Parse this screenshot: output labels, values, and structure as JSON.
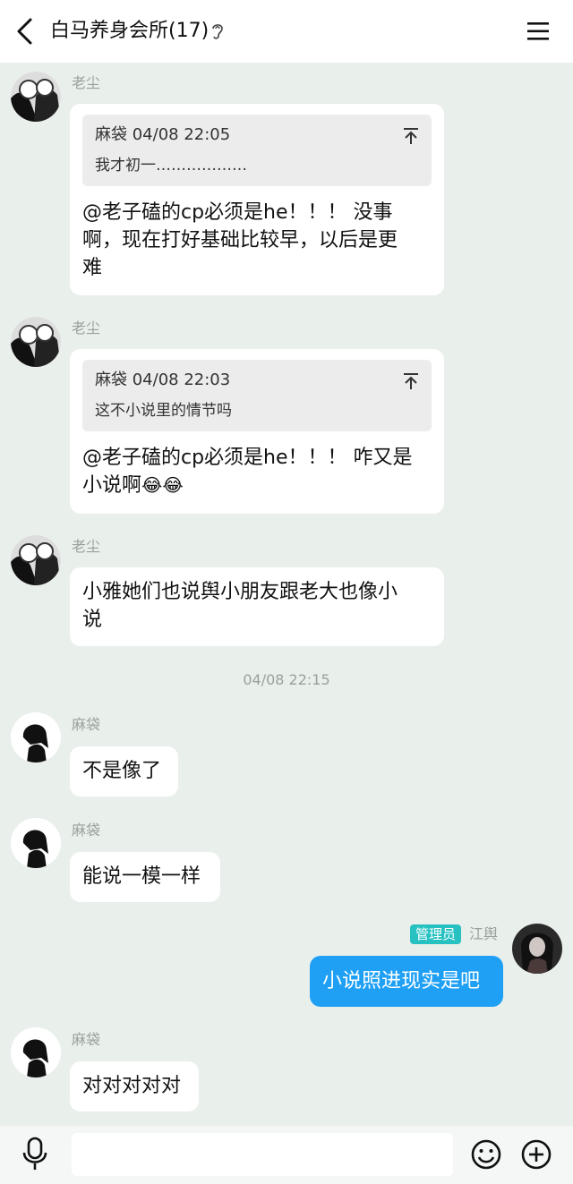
{
  "header": {
    "title": "白马养身会所(17)"
  },
  "messages": [
    {
      "sender": "老尘",
      "quote": {
        "author_time": "麻袋 04/08 22:05",
        "text": "我才初一………………"
      },
      "text_lines": [
        "@老子磕的cp必须是he！！！ 没事",
        "啊，现在打好基础比较早，以后是更",
        "难"
      ]
    },
    {
      "sender": "老尘",
      "quote": {
        "author_time": "麻袋 04/08 22:03",
        "text": "这不小说里的情节吗"
      },
      "text_lines": [
        "@老子磕的cp必须是he！！！ 咋又是",
        "小说啊"
      ],
      "emoji": "😂😂"
    },
    {
      "sender": "老尘",
      "text_lines": [
        "小雅她们也说舆小朋友跟老大也像小",
        "说"
      ]
    },
    {
      "timestamp": "04/08 22:15"
    },
    {
      "sender": "麻袋",
      "text": "不是像了"
    },
    {
      "sender": "麻袋",
      "text": "能说一模一样"
    },
    {
      "sender": "江舆",
      "badge": "管理员",
      "text": "小说照进现实是吧",
      "mine": true
    },
    {
      "sender": "麻袋",
      "text": "对对对对对"
    }
  ],
  "input": {
    "value": ""
  },
  "colors": {
    "bg": "#e9efeb",
    "mine_bubble": "#1fa0f5",
    "admin_badge": "#27c1c1"
  }
}
